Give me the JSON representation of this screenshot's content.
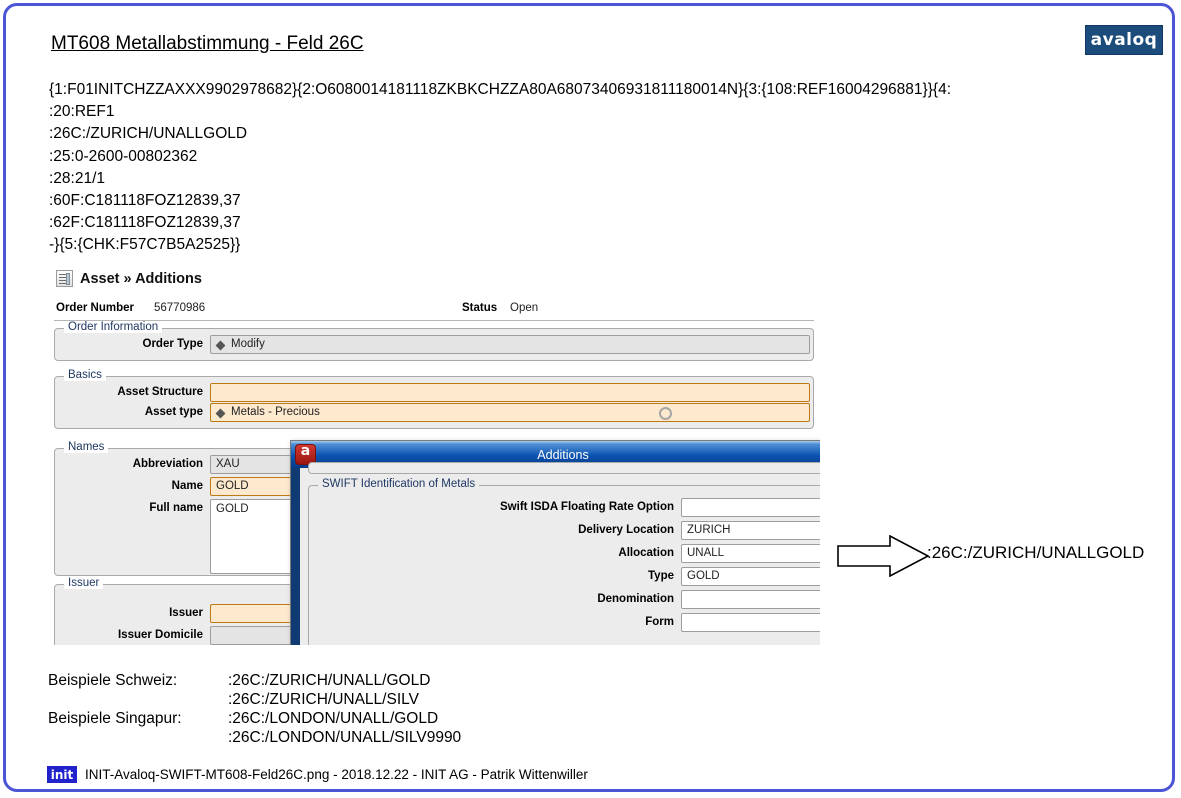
{
  "slide": {
    "title": "MT608 Metallabstimmung - Feld 26C",
    "logo_text": "avaloq",
    "border_color": "#4b55d6"
  },
  "swift_message": {
    "lines": [
      "{1:F01INITCHZZAXXX9902978682}{2:O6080014181118ZKBKCHZZA80A68073406931811180014N}{3:{108:REF16004296881}}{4:",
      ":20:REF1",
      ":26C:/ZURICH/UNALLGOLD",
      ":25:0-2600-00802362",
      ":28:21/1",
      ":60F:C181118FOZ12839,37",
      ":62F:C181118FOZ12839,37",
      "-}{5:{CHK:F57C7B5A2525}}"
    ],
    "text": "{1:F01INITCHZZAXXX9902978682}{2:O6080014181118ZKBKCHZZA80A68073406931811180014N}{3:{108:REF16004296881}}{4:\n:20:REF1\n:26C:/ZURICH/UNALLGOLD\n:25:0-2600-00802362\n:28:21/1\n:60F:C181118FOZ12839,37\n:62F:C181118FOZ12839,37\n-}{5:{CHK:F57C7B5A2525}}"
  },
  "app": {
    "header": {
      "title": "Asset » Additions",
      "icon": "document-icon"
    },
    "meta": {
      "order_number_label": "Order Number",
      "order_number_value": "56770986",
      "status_label": "Status",
      "status_value": "Open"
    },
    "groups": {
      "order_information": {
        "legend": "Order Information",
        "fields": [
          {
            "label": "Order Type",
            "value": "Modify",
            "type": "combo",
            "state": "normal"
          }
        ]
      },
      "basics": {
        "legend": "Basics",
        "fields": [
          {
            "label": "Asset Structure",
            "value": "",
            "type": "text",
            "state": "highlight"
          },
          {
            "label": "Asset type",
            "value": "Metals - Precious",
            "type": "combo",
            "state": "highlight"
          }
        ]
      },
      "names": {
        "legend": "Names",
        "fields": [
          {
            "label": "Abbreviation",
            "value": "XAU",
            "type": "text",
            "state": "normal"
          },
          {
            "label": "Name",
            "value": "GOLD",
            "type": "text",
            "state": "highlight"
          },
          {
            "label": "Full name",
            "value": "GOLD",
            "type": "textarea",
            "state": "white"
          }
        ]
      },
      "issuer": {
        "legend": "Issuer",
        "fields": [
          {
            "label": "Issuer",
            "value": "",
            "type": "text",
            "state": "highlight"
          },
          {
            "label": "Issuer Domicile",
            "value": "",
            "type": "text",
            "state": "normal"
          }
        ]
      }
    }
  },
  "dialog": {
    "title": "Additions",
    "app_icon": "avaloq-app-icon",
    "group": {
      "legend": "SWIFT Identification of Metals",
      "fields": [
        {
          "label": "Swift ISDA Floating Rate Option",
          "value": ""
        },
        {
          "label": "Delivery Location",
          "value": "ZURICH"
        },
        {
          "label": "Allocation",
          "value": "UNALL"
        },
        {
          "label": "Type",
          "value": "GOLD"
        },
        {
          "label": "Denomination",
          "value": ""
        },
        {
          "label": "Form",
          "value": ""
        }
      ]
    }
  },
  "callout": {
    "arrow": "right-arrow-icon",
    "text": ":26C:/ZURICH/UNALLGOLD"
  },
  "examples": [
    {
      "label": "Beispiele Schweiz:",
      "value": ":26C:/ZURICH/UNALL/GOLD"
    },
    {
      "label": "",
      "value": ":26C:/ZURICH/UNALL/SILV"
    },
    {
      "label": "Beispiele Singapur:",
      "value": ":26C:/LONDON/UNALL/GOLD"
    },
    {
      "label": "",
      "value": ":26C:/LONDON/UNALL/SILV9990"
    }
  ],
  "footer": {
    "logo_text": "init",
    "text": "INIT-Avaloq-SWIFT-MT608-Feld26C.png - 2018.12.22 - INIT AG - Patrik Wittenwiller"
  }
}
